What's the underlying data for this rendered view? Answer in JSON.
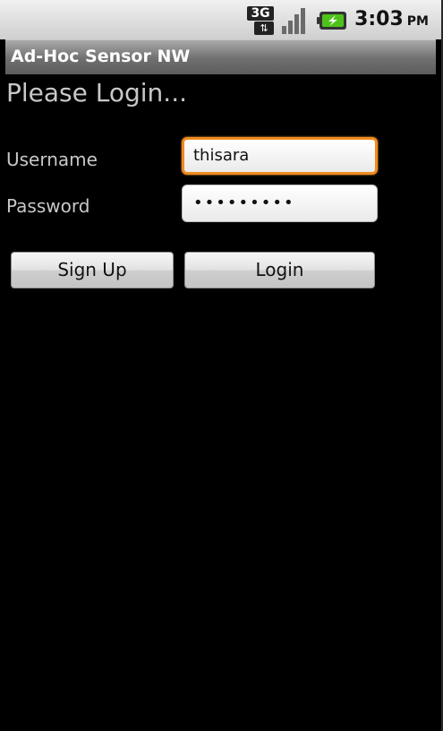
{
  "status_bar": {
    "network_type": "3G",
    "network_activity": "⇅",
    "signal_icon": "signal-bars-icon",
    "battery_icon": "battery-charging-icon",
    "time": "3:03",
    "ampm": "PM"
  },
  "app": {
    "title": "Ad-Hoc Sensor NW"
  },
  "login": {
    "heading": "Please Login...",
    "username_label": "Username",
    "username_value": "thisara",
    "password_label": "Password",
    "password_masked": "•••••••••",
    "signup_label": "Sign Up",
    "login_label": "Login"
  },
  "colors": {
    "focus_border": "#f08a21",
    "battery_green": "#4fc21a",
    "background": "#000000"
  }
}
